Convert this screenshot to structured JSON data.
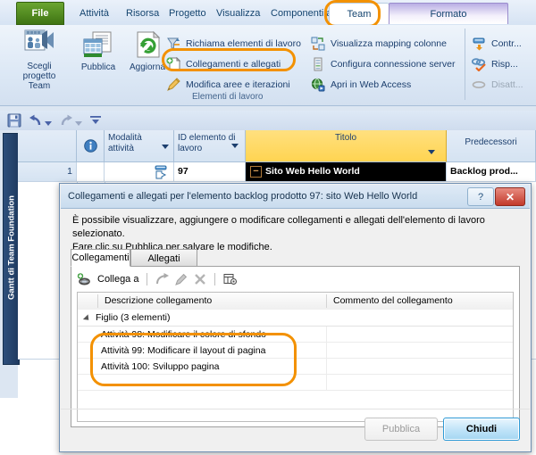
{
  "ribbon": {
    "tabs": [
      {
        "label": "File",
        "name": "tab-file"
      },
      {
        "label": "Attività",
        "name": "tab-attivita"
      },
      {
        "label": "Risorsa",
        "name": "tab-risorsa"
      },
      {
        "label": "Progetto",
        "name": "tab-progetto"
      },
      {
        "label": "Visualizza",
        "name": "tab-visualizza"
      },
      {
        "label": "Componenti aggiuntivi",
        "name": "tab-componenti-aggiuntivi"
      },
      {
        "label": "Team",
        "name": "tab-team"
      },
      {
        "label": "Formato",
        "name": "tab-formato"
      }
    ],
    "active_tab": "Team",
    "highlight_color": "#f39100",
    "buttons": {
      "scegli_progetto_team": "Scegli\nprogetto\nTeam",
      "scegli_line1": "Scegli",
      "scegli_line2": "progetto",
      "scegli_line3": "Team",
      "pubblica": "Pubblica",
      "aggiorna": "Aggiorna"
    },
    "commands": [
      {
        "label": "Richiama elementi di lavoro",
        "icon": "recall-icon",
        "disabled": false
      },
      {
        "label": "Collegamenti e allegati",
        "icon": "links-attachments-icon",
        "disabled": false,
        "highlighted": true
      },
      {
        "label": "Modifica aree e iterazioni",
        "icon": "pencil-icon",
        "disabled": false
      },
      {
        "label": "Visualizza mapping colonne",
        "icon": "column-mapping-icon",
        "disabled": false
      },
      {
        "label": "Configura connessione server",
        "icon": "server-icon",
        "disabled": false
      },
      {
        "label": "Apri in Web Access",
        "icon": "globe-icon",
        "disabled": false
      }
    ],
    "right_commands": [
      {
        "label": "Contr...",
        "icon": "control-icon",
        "disabled": false
      },
      {
        "label": "Risp...",
        "icon": "link-check-icon",
        "disabled": false
      },
      {
        "label": "Disatt...",
        "icon": "disable-icon",
        "disabled": true
      }
    ],
    "group_label": "Elementi di lavoro"
  },
  "quick_access": {
    "icons": [
      "save-icon",
      "undo-icon",
      "undo-dropdown-icon",
      "redo-icon",
      "redo-dropdown-icon",
      "customize-qat-icon"
    ]
  },
  "side_tab": {
    "label": "Gantt di Team Foundation"
  },
  "grid": {
    "columns": [
      {
        "label": "",
        "name": "col-indicator-blank"
      },
      {
        "label": "",
        "name": "col-info",
        "icon": "info-icon"
      },
      {
        "label": "Modalità attività",
        "name": "col-modalita-attivita",
        "has_dropdown": true
      },
      {
        "label": "ID elemento di lavoro",
        "name": "col-id-elemento-di-lavoro",
        "has_dropdown": true
      },
      {
        "label": "Titolo",
        "name": "col-titolo",
        "has_dropdown": true,
        "selected": true
      },
      {
        "label": "Predecessori",
        "name": "col-predecessori"
      }
    ],
    "rows": [
      {
        "number": "1",
        "modalita": "",
        "id_elemento": "97",
        "titolo": "Sito Web Hello World",
        "predecessori": "Backlog prod..."
      }
    ],
    "selected_column_color": "#ffd451"
  },
  "dialog": {
    "title": "Collegamenti e allegati per l'elemento backlog prodotto 97: sito Web Hello World",
    "help_button": "?",
    "close_button": "✕",
    "description_line1": "È possibile visualizzare, aggiungere o modificare collegamenti e allegati dell'elemento di lavoro selezionato.",
    "description_line2": "Fare clic su Pubblica per salvare le modifiche.",
    "tabs": [
      {
        "label": "Collegamenti",
        "active": true
      },
      {
        "label": "Allegati",
        "active": false
      }
    ],
    "toolbar": {
      "collega_a": "Collega a",
      "icons": [
        "add-link-icon",
        "open-link-icon",
        "edit-icon",
        "delete-icon",
        "column-options-icon"
      ]
    },
    "list": {
      "headers": [
        "Descrizione collegamento",
        "Commento del collegamento"
      ],
      "group": "Figlio (3 elementi)",
      "items": [
        {
          "description": "Attività 98: Modificare il colore di sfondo",
          "comment": ""
        },
        {
          "description": "Attività 99: Modificare il layout di pagina",
          "comment": ""
        },
        {
          "description": "Attività 100: Sviluppo pagina",
          "comment": ""
        }
      ]
    },
    "buttons": {
      "pubblica": "Pubblica",
      "chiudi": "Chiudi"
    }
  }
}
